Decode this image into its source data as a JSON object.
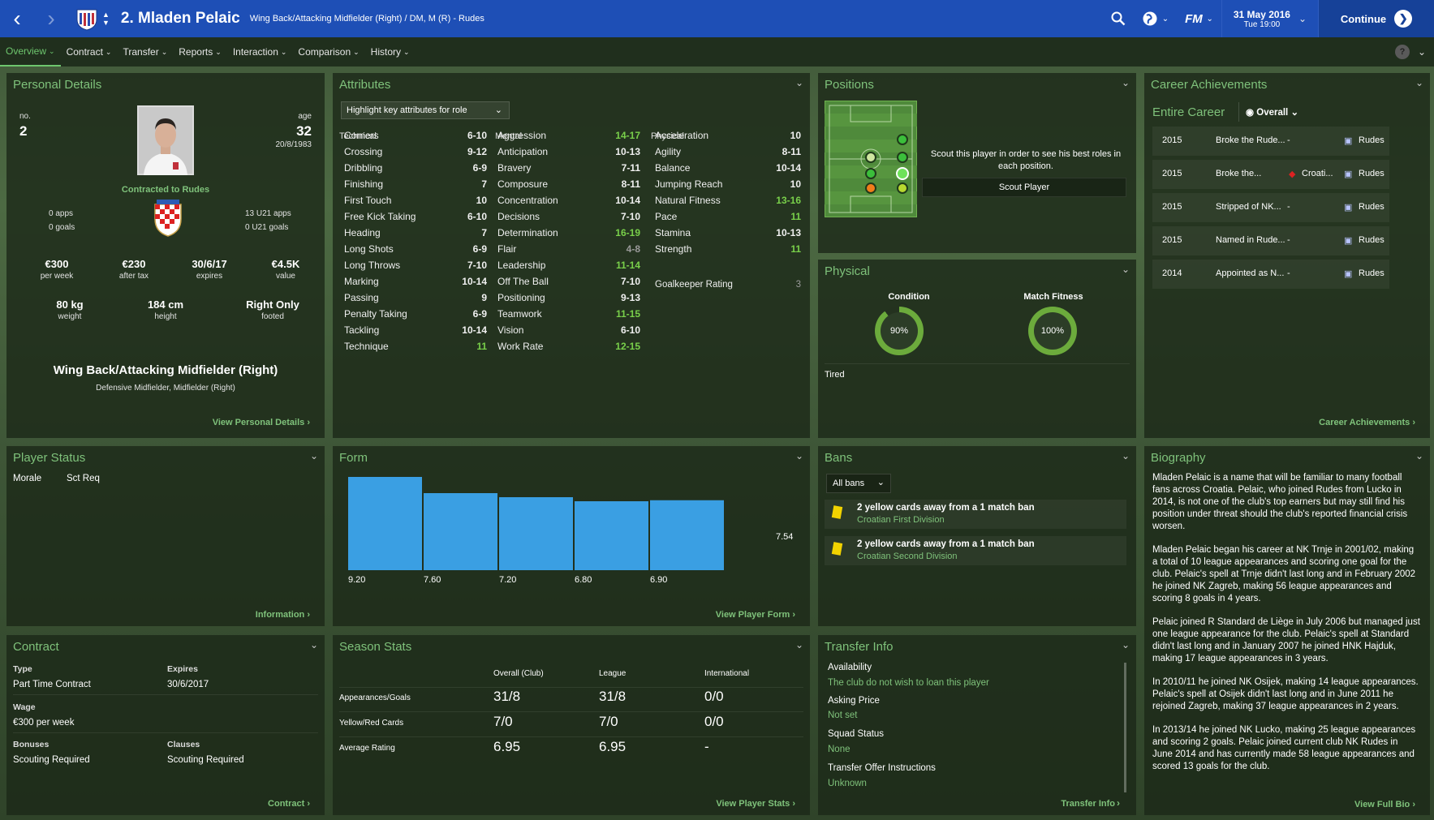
{
  "header": {
    "player_title": "2. Mladen Pelaic",
    "subtitle": "Wing Back/Attacking Midfielder (Right) / DM, M (R) - Rudes",
    "date": "31 May 2016",
    "time": "Tue 19:00",
    "continue_label": "Continue",
    "fm_label": "FM"
  },
  "tabs": [
    {
      "label": "Overview"
    },
    {
      "label": "Contract"
    },
    {
      "label": "Transfer"
    },
    {
      "label": "Reports"
    },
    {
      "label": "Interaction"
    },
    {
      "label": "Comparison"
    },
    {
      "label": "History"
    }
  ],
  "personal": {
    "title": "Personal Details",
    "no_label": "no.",
    "no": "2",
    "age_label": "age",
    "age": "32",
    "dob": "20/8/1983",
    "contracted": "Contracted to Rudes",
    "apps": "0 apps",
    "goals": "0 goals",
    "u21_apps": "13 U21 apps",
    "u21_goals": "0 U21 goals",
    "stats": [
      {
        "v": "€300",
        "l": "per week"
      },
      {
        "v": "€230",
        "l": "after tax"
      },
      {
        "v": "30/6/17",
        "l": "expires"
      },
      {
        "v": "€4.5K",
        "l": "value"
      }
    ],
    "body": [
      {
        "v": "80 kg",
        "l": "weight"
      },
      {
        "v": "184 cm",
        "l": "height"
      },
      {
        "v": "Right Only",
        "l": "footed"
      }
    ],
    "position": "Wing Back/Attacking Midfielder (Right)",
    "secondary": "Defensive Midfielder, Midfielder (Right)",
    "link": "View Personal Details"
  },
  "attributes": {
    "title": "Attributes",
    "dropdown": "Highlight key attributes for role",
    "technical_header": "Technical",
    "mental_header": "Mental",
    "physical_header": "Physical",
    "technical": [
      {
        "n": "Corners",
        "v": "6-10"
      },
      {
        "n": "Crossing",
        "v": "9-12"
      },
      {
        "n": "Dribbling",
        "v": "6-9"
      },
      {
        "n": "Finishing",
        "v": "7"
      },
      {
        "n": "First Touch",
        "v": "10"
      },
      {
        "n": "Free Kick Taking",
        "v": "6-10"
      },
      {
        "n": "Heading",
        "v": "7"
      },
      {
        "n": "Long Shots",
        "v": "6-9"
      },
      {
        "n": "Long Throws",
        "v": "7-10"
      },
      {
        "n": "Marking",
        "v": "10-14"
      },
      {
        "n": "Passing",
        "v": "9"
      },
      {
        "n": "Penalty Taking",
        "v": "6-9"
      },
      {
        "n": "Tackling",
        "v": "10-14"
      },
      {
        "n": "Technique",
        "v": "11",
        "k": "g"
      }
    ],
    "mental": [
      {
        "n": "Aggression",
        "v": "14-17",
        "k": "g"
      },
      {
        "n": "Anticipation",
        "v": "10-13"
      },
      {
        "n": "Bravery",
        "v": "7-11"
      },
      {
        "n": "Composure",
        "v": "8-11"
      },
      {
        "n": "Concentration",
        "v": "10-14"
      },
      {
        "n": "Decisions",
        "v": "7-10"
      },
      {
        "n": "Determination",
        "v": "16-19",
        "k": "g"
      },
      {
        "n": "Flair",
        "v": "4-8",
        "k": "dim"
      },
      {
        "n": "Leadership",
        "v": "11-14",
        "k": "g"
      },
      {
        "n": "Off The Ball",
        "v": "7-10"
      },
      {
        "n": "Positioning",
        "v": "9-13"
      },
      {
        "n": "Teamwork",
        "v": "11-15",
        "k": "g"
      },
      {
        "n": "Vision",
        "v": "6-10"
      },
      {
        "n": "Work Rate",
        "v": "12-15",
        "k": "g"
      }
    ],
    "physical": [
      {
        "n": "Acceleration",
        "v": "10"
      },
      {
        "n": "Agility",
        "v": "8-11"
      },
      {
        "n": "Balance",
        "v": "10-14"
      },
      {
        "n": "Jumping Reach",
        "v": "10"
      },
      {
        "n": "Natural Fitness",
        "v": "13-16",
        "k": "g"
      },
      {
        "n": "Pace",
        "v": "11",
        "k": "g"
      },
      {
        "n": "Stamina",
        "v": "10-13"
      },
      {
        "n": "Strength",
        "v": "11",
        "k": "g"
      }
    ],
    "gk_label": "Goalkeeper Rating",
    "gk_value": "3"
  },
  "positions": {
    "title": "Positions",
    "msg": "Scout this player in order to see his best roles in each position.",
    "button": "Scout Player"
  },
  "physical": {
    "title": "Physical",
    "condition_label": "Condition",
    "condition": "90%",
    "condition_value": 0.9,
    "fitness_label": "Match Fitness",
    "fitness": "100%",
    "fitness_value": 1.0,
    "state": "Tired",
    "accent": "#6cab3c"
  },
  "career": {
    "title": "Career Achievements",
    "filter_left": "Entire Career",
    "filter_right": "Overall",
    "link": "Career Achievements",
    "rows": [
      {
        "year": "2015",
        "desc": "Broke the Rude...",
        "dash": "-",
        "club": "Rudes"
      },
      {
        "year": "2015",
        "desc": "Broke the...",
        "dash": "",
        "nation": "Croati...",
        "club": "Rudes"
      },
      {
        "year": "2015",
        "desc": "Stripped of NK...",
        "dash": "-",
        "club": "Rudes"
      },
      {
        "year": "2015",
        "desc": "Named in Rude...",
        "dash": "-",
        "club": "Rudes"
      },
      {
        "year": "2014",
        "desc": "Appointed as N...",
        "dash": "-",
        "club": "Rudes"
      }
    ]
  },
  "status": {
    "title": "Player Status",
    "morale": "Morale",
    "sct": "Sct Req",
    "link": "Information"
  },
  "form": {
    "title": "Form",
    "link": "View Player Form",
    "value_label": "7.54"
  },
  "chart_data": {
    "type": "bar",
    "categories": [
      "9.20",
      "7.60",
      "7.20",
      "6.80",
      "6.90"
    ],
    "values": [
      9.2,
      7.6,
      7.2,
      6.8,
      6.9
    ],
    "title": "Form",
    "reference_line": 7.54,
    "color": "#3a9fe3"
  },
  "bans": {
    "title": "Bans",
    "dropdown": "All bans",
    "items": [
      {
        "text": "2 yellow cards away from a 1 match ban",
        "comp": "Croatian First Division"
      },
      {
        "text": "2 yellow cards away from a 1 match ban",
        "comp": "Croatian Second Division"
      }
    ]
  },
  "bio": {
    "title": "Biography",
    "link": "View Full Bio",
    "paragraphs": [
      "Mladen Pelaic is a name that will be familiar to many football fans across Croatia. Pelaic, who joined Rudes from Lucko in 2014, is not one of the club's top earners but may still find his position under threat should the club's reported financial crisis worsen.",
      "Mladen Pelaic began his career at NK Trnje in 2001/02, making a total of 10 league appearances and scoring one goal for the club. Pelaic's spell at Trnje didn't last long and in February 2002 he joined NK Zagreb, making 56 league appearances and scoring 8 goals in 4 years.",
      "Pelaic joined R Standard de Liège in July 2006 but managed just one league appearance for the club. Pelaic's spell at Standard didn't last long and in January 2007 he joined HNK Hajduk, making 17 league appearances in 3 years.",
      "In 2010/11 he joined NK Osijek, making 14 league appearances. Pelaic's spell at Osijek didn't last long and in June 2011 he rejoined Zagreb, making 37 league appearances in 2 years.",
      "In 2013/14 he joined NK Lucko, making 25 league appearances and scoring 2 goals. Pelaic joined current club NK Rudes in June 2014 and has currently made 58 league appearances and scored 13 goals for the club."
    ]
  },
  "contract": {
    "title": "Contract",
    "type_label": "Type",
    "type": "Part Time Contract",
    "expires_label": "Expires",
    "expires": "30/6/2017",
    "wage_label": "Wage",
    "wage": "€300 per week",
    "bonuses_label": "Bonuses",
    "bonuses": "Scouting Required",
    "clauses_label": "Clauses",
    "clauses": "Scouting Required",
    "link": "Contract"
  },
  "season": {
    "title": "Season Stats",
    "cols": [
      "Overall (Club)",
      "League",
      "International"
    ],
    "rows": [
      {
        "label": "Appearances/Goals",
        "vals": [
          "31/8",
          "31/8",
          "0/0"
        ]
      },
      {
        "label": "Yellow/Red Cards",
        "vals": [
          "7/0",
          "7/0",
          "0/0"
        ]
      },
      {
        "label": "Average Rating",
        "vals": [
          "6.95",
          "6.95",
          "-"
        ]
      }
    ],
    "link": "View Player Stats"
  },
  "transfer": {
    "title": "Transfer Info",
    "availability_label": "Availability",
    "availability": "The club do not wish to loan this player",
    "price_label": "Asking Price",
    "price": "Not set",
    "squad_label": "Squad Status",
    "squad": "None",
    "offer_label": "Transfer Offer Instructions",
    "offer": "Unknown",
    "link": "Transfer Info"
  }
}
